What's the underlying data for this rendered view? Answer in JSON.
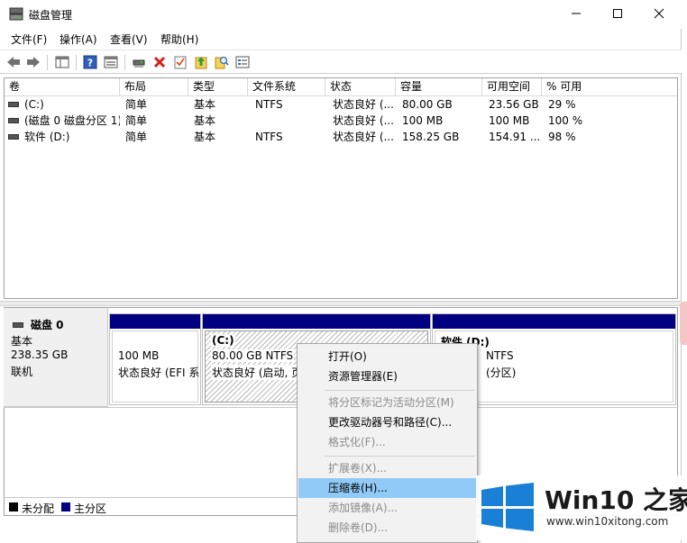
{
  "window": {
    "title": "磁盘管理",
    "controls": {
      "minimize": "minimize-icon",
      "maximize": "maximize-icon",
      "close": "close-icon"
    }
  },
  "menubar": {
    "items": [
      {
        "label": "文件(F)"
      },
      {
        "label": "操作(A)"
      },
      {
        "label": "查看(V)"
      },
      {
        "label": "帮助(H)"
      }
    ]
  },
  "toolbar": {
    "icons": [
      "back-arrow-icon",
      "forward-arrow-icon",
      "console-icon",
      "help-icon",
      "properties-icon",
      "connect-icon",
      "delete-icon",
      "checklist-icon",
      "import-icon",
      "search-icon",
      "properties-sheet-icon"
    ]
  },
  "volume_table": {
    "columns": [
      "卷",
      "布局",
      "类型",
      "文件系统",
      "状态",
      "容量",
      "可用空间",
      "% 可用"
    ],
    "rows": [
      [
        "(C:)",
        "简单",
        "基本",
        "NTFS",
        "状态良好 (...",
        "80.00 GB",
        "23.56 GB",
        "29 %"
      ],
      [
        "(磁盘 0 磁盘分区 1)",
        "简单",
        "基本",
        "",
        "状态良好 (...",
        "100 MB",
        "100 MB",
        "100 %"
      ],
      [
        "软件 (D:)",
        "简单",
        "基本",
        "NTFS",
        "状态良好 (...",
        "158.25 GB",
        "154.91 ...",
        "98 %"
      ]
    ]
  },
  "disk0": {
    "name": "磁盘 0",
    "type": "基本",
    "size": "238.35 GB",
    "status": "联机",
    "partitions": [
      {
        "title": "",
        "size": "100 MB",
        "status": "状态良好 (EFI 系"
      },
      {
        "title": "(C:)",
        "size": "80.00 GB NTFS",
        "status": "状态良好 (启动, 页"
      },
      {
        "title": "软件 (D:)",
        "size": "NTFS",
        "status": "(分区)"
      }
    ]
  },
  "legend": {
    "items": [
      {
        "label": "未分配",
        "color": "#000000"
      },
      {
        "label": "主分区",
        "color": "#000080"
      }
    ]
  },
  "context_menu": {
    "items": [
      {
        "label": "打开(O)",
        "enabled": true
      },
      {
        "label": "资源管理器(E)",
        "enabled": true
      },
      {
        "label": "将分区标记为活动分区(M)",
        "enabled": false
      },
      {
        "label": "更改驱动器号和路径(C)...",
        "enabled": true
      },
      {
        "label": "格式化(F)...",
        "enabled": false
      },
      {
        "label": "扩展卷(X)...",
        "enabled": false
      },
      {
        "label": "压缩卷(H)...",
        "enabled": true,
        "highlighted": true
      },
      {
        "label": "添加镜像(A)...",
        "enabled": false
      },
      {
        "label": "删除卷(D)...",
        "enabled": false
      }
    ]
  },
  "watermark": {
    "title": "Win10 之家",
    "url": "www.win10xitong.com",
    "colors": {
      "accent": "#1a7fd6"
    }
  },
  "colors": {
    "primary_partition": "#000080",
    "menu_highlight": "#91c9f7"
  }
}
